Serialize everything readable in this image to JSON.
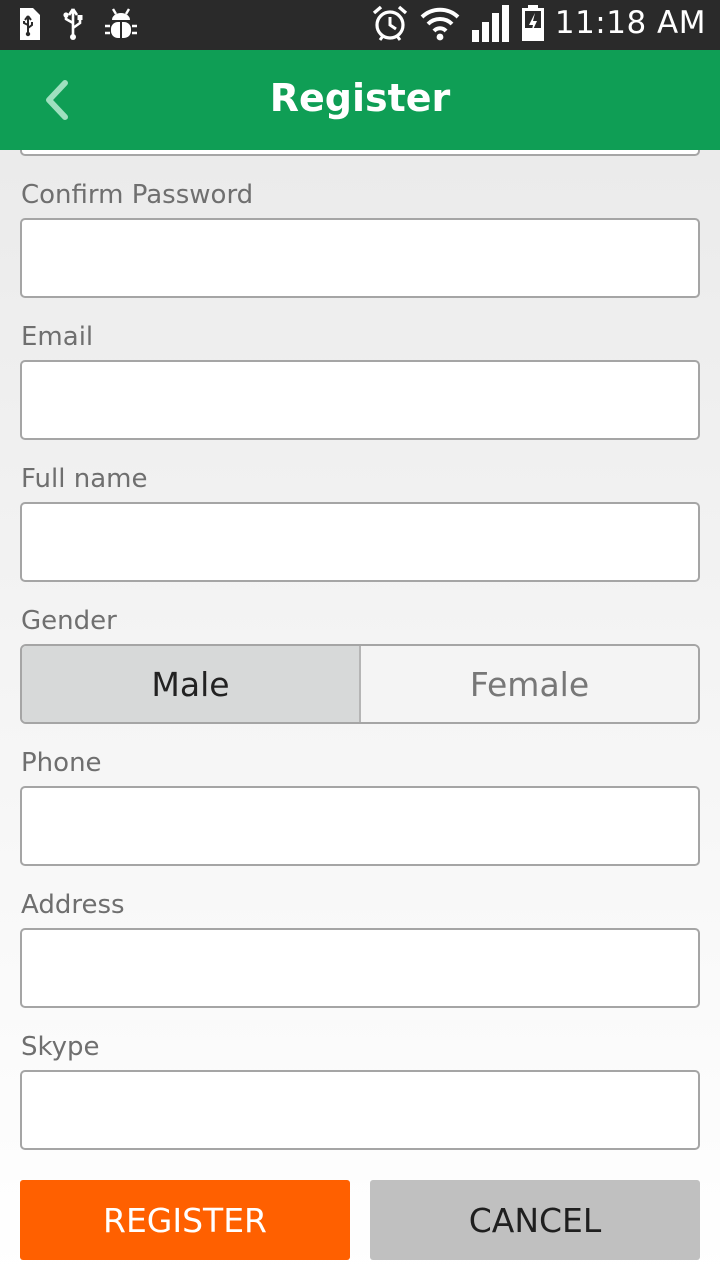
{
  "status_bar": {
    "time": "11:18 AM",
    "left_icons": [
      "usb-storage-icon",
      "usb-icon",
      "debug-bug-icon"
    ],
    "right_icons": [
      "alarm-icon",
      "wifi-icon",
      "signal-icon",
      "battery-charging-icon"
    ]
  },
  "app_bar": {
    "title": "Register",
    "back_icon": "chevron-left-icon",
    "color": "#0f9e55"
  },
  "form": {
    "confirm_password": {
      "label": "Confirm Password",
      "value": ""
    },
    "email": {
      "label": "Email",
      "value": ""
    },
    "full_name": {
      "label": "Full name",
      "value": ""
    },
    "gender": {
      "label": "Gender",
      "options": [
        "Male",
        "Female"
      ],
      "selected": "Male"
    },
    "phone": {
      "label": "Phone",
      "value": ""
    },
    "address": {
      "label": "Address",
      "value": ""
    },
    "skype": {
      "label": "Skype",
      "value": ""
    }
  },
  "buttons": {
    "register": {
      "label": "REGISTER",
      "color": "#ff6000"
    },
    "cancel": {
      "label": "CANCEL",
      "color": "#c0c0c0"
    }
  }
}
